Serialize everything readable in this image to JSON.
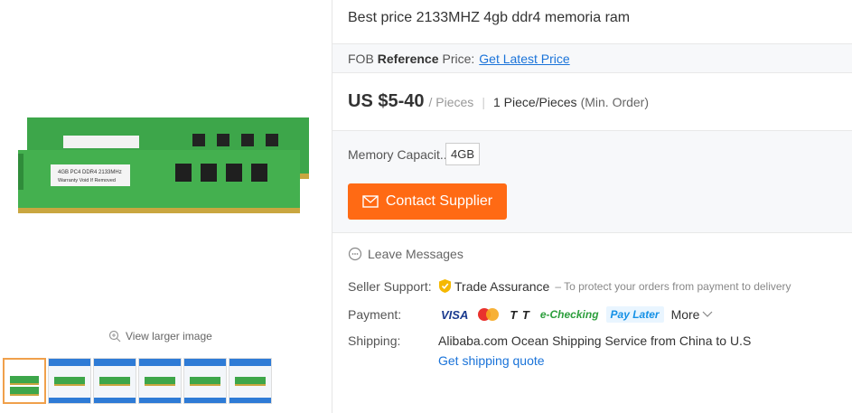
{
  "gallery": {
    "main_image_alt": "4GB PC4 DDR4 2133MHz",
    "label_line1": "4GB PC4 DDR4 2133MHz",
    "label_line2": "Warranty  Void If  Removed",
    "view_larger": "View larger image",
    "thumb_count": 6
  },
  "product": {
    "title": "Best price 2133MHZ 4gb ddr4 memoria ram"
  },
  "fob": {
    "prefix": "FOB",
    "bold": "Reference",
    "suffix": "Price:",
    "link": "Get Latest Price"
  },
  "price": {
    "amount": "US $5-40",
    "unit": "/ Pieces",
    "separator": "|",
    "moq": "1 Piece/Pieces",
    "moq_note": "(Min. Order)"
  },
  "attributes": {
    "label": "Memory Capacit...",
    "value": "4GB"
  },
  "contact": {
    "label": "Contact Supplier",
    "icon": "envelope-icon"
  },
  "leave_messages": {
    "label": "Leave Messages",
    "icon": "chat-bubble-icon"
  },
  "seller_support": {
    "label": "Seller Support:",
    "trade": "Trade Assurance",
    "note": "– To protect your orders from payment to delivery"
  },
  "payment": {
    "label": "Payment:",
    "methods": [
      "VISA",
      "Mastercard",
      "TT",
      "e-Checking",
      "Pay Later"
    ],
    "visa": "VISA",
    "tt": "T T",
    "echeck": "e-Checking",
    "paylater": "Pay Later",
    "more": "More"
  },
  "shipping": {
    "label": "Shipping:",
    "text": "Alibaba.com Ocean Shipping Service from China to U.S",
    "link": "Get shipping quote"
  },
  "colors": {
    "accent": "#ff6a14",
    "link": "#1a73d9",
    "ram_green": "#3da64a"
  }
}
